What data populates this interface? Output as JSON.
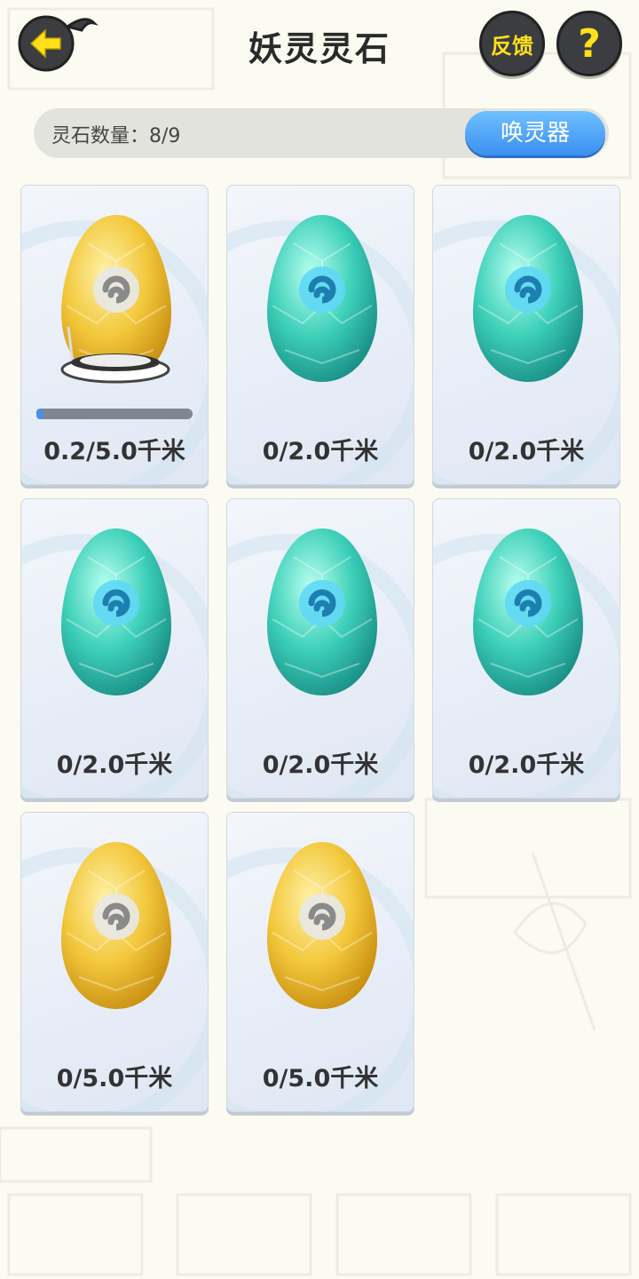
{
  "header": {
    "title": "妖灵灵石",
    "feedback_label": "反馈",
    "help_label": "?"
  },
  "count_bar": {
    "label": "灵石数量：8/9",
    "summon_label": "唤灵器"
  },
  "colors": {
    "gold": "#f2c73a",
    "teal": "#3ccfb8",
    "accent_blue": "#4a90e2",
    "button_yellow": "#ffe01a"
  },
  "stones": [
    {
      "type": "gold",
      "distance": "0.2/5.0千米",
      "progress": 0.04,
      "incubating": true
    },
    {
      "type": "teal",
      "distance": "0/2.0千米"
    },
    {
      "type": "teal",
      "distance": "0/2.0千米"
    },
    {
      "type": "teal",
      "distance": "0/2.0千米"
    },
    {
      "type": "teal",
      "distance": "0/2.0千米"
    },
    {
      "type": "teal",
      "distance": "0/2.0千米"
    },
    {
      "type": "gold",
      "distance": "0/5.0千米"
    },
    {
      "type": "gold",
      "distance": "0/5.0千米"
    }
  ]
}
